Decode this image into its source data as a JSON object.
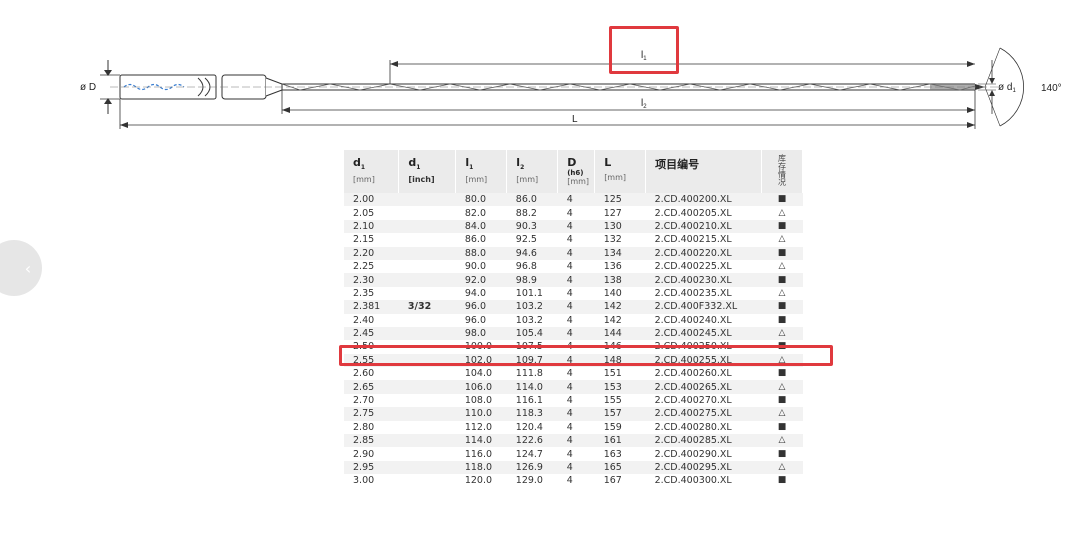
{
  "drawing": {
    "label_l1": "l",
    "label_l1_sub": "1",
    "label_l2": "l",
    "label_l2_sub": "2",
    "label_L": "L",
    "label_D": "ø D",
    "label_d1": "ø d",
    "label_d1_sub": "1",
    "label_angle": "140°"
  },
  "nav": {
    "prev_glyph": "‹"
  },
  "table": {
    "headers": [
      {
        "title": "d",
        "sub": "1",
        "unit": "[mm]"
      },
      {
        "title": "d",
        "sub": "1",
        "unit": "[inch]"
      },
      {
        "title": "l",
        "sub": "1",
        "unit": "[mm]"
      },
      {
        "title": "l",
        "sub": "2",
        "unit": "[mm]"
      },
      {
        "title": "D",
        "sub": "",
        "extra": "(h6)",
        "unit": "[mm]"
      },
      {
        "title": "L",
        "sub": "",
        "unit": "[mm]"
      },
      {
        "title": "项目编号",
        "sub": "",
        "unit": ""
      },
      {
        "title": "库存情况",
        "sub": "",
        "unit": ""
      }
    ],
    "rows": [
      [
        "2.00",
        "",
        "80.0",
        "86.0",
        "4",
        "125",
        "2.CD.400200.XL",
        "■"
      ],
      [
        "2.05",
        "",
        "82.0",
        "88.2",
        "4",
        "127",
        "2.CD.400205.XL",
        "△"
      ],
      [
        "2.10",
        "",
        "84.0",
        "90.3",
        "4",
        "130",
        "2.CD.400210.XL",
        "■"
      ],
      [
        "2.15",
        "",
        "86.0",
        "92.5",
        "4",
        "132",
        "2.CD.400215.XL",
        "△"
      ],
      [
        "2.20",
        "",
        "88.0",
        "94.6",
        "4",
        "134",
        "2.CD.400220.XL",
        "■"
      ],
      [
        "2.25",
        "",
        "90.0",
        "96.8",
        "4",
        "136",
        "2.CD.400225.XL",
        "△"
      ],
      [
        "2.30",
        "",
        "92.0",
        "98.9",
        "4",
        "138",
        "2.CD.400230.XL",
        "■"
      ],
      [
        "2.35",
        "",
        "94.0",
        "101.1",
        "4",
        "140",
        "2.CD.400235.XL",
        "△"
      ],
      [
        "2.381",
        "3/32",
        "96.0",
        "103.2",
        "4",
        "142",
        "2.CD.400F332.XL",
        "■"
      ],
      [
        "2.40",
        "",
        "96.0",
        "103.2",
        "4",
        "142",
        "2.CD.400240.XL",
        "■"
      ],
      [
        "2.45",
        "",
        "98.0",
        "105.4",
        "4",
        "144",
        "2.CD.400245.XL",
        "△"
      ],
      [
        "2.50",
        "",
        "100.0",
        "107.5",
        "4",
        "146",
        "2.CD.400250.XL",
        "■"
      ],
      [
        "2.55",
        "",
        "102.0",
        "109.7",
        "4",
        "148",
        "2.CD.400255.XL",
        "△"
      ],
      [
        "2.60",
        "",
        "104.0",
        "111.8",
        "4",
        "151",
        "2.CD.400260.XL",
        "■"
      ],
      [
        "2.65",
        "",
        "106.0",
        "114.0",
        "4",
        "153",
        "2.CD.400265.XL",
        "△"
      ],
      [
        "2.70",
        "",
        "108.0",
        "116.1",
        "4",
        "155",
        "2.CD.400270.XL",
        "■"
      ],
      [
        "2.75",
        "",
        "110.0",
        "118.3",
        "4",
        "157",
        "2.CD.400275.XL",
        "△"
      ],
      [
        "2.80",
        "",
        "112.0",
        "120.4",
        "4",
        "159",
        "2.CD.400280.XL",
        "■"
      ],
      [
        "2.85",
        "",
        "114.0",
        "122.6",
        "4",
        "161",
        "2.CD.400285.XL",
        "△"
      ],
      [
        "2.90",
        "",
        "116.0",
        "124.7",
        "4",
        "163",
        "2.CD.400290.XL",
        "■"
      ],
      [
        "2.95",
        "",
        "118.0",
        "126.9",
        "4",
        "165",
        "2.CD.400295.XL",
        "△"
      ],
      [
        "3.00",
        "",
        "120.0",
        "129.0",
        "4",
        "167",
        "2.CD.400300.XL",
        "■"
      ]
    ]
  },
  "colors": {
    "highlight": "#e0393e",
    "header_bg": "#ebebeb",
    "stripe": "#f2f2f2"
  }
}
